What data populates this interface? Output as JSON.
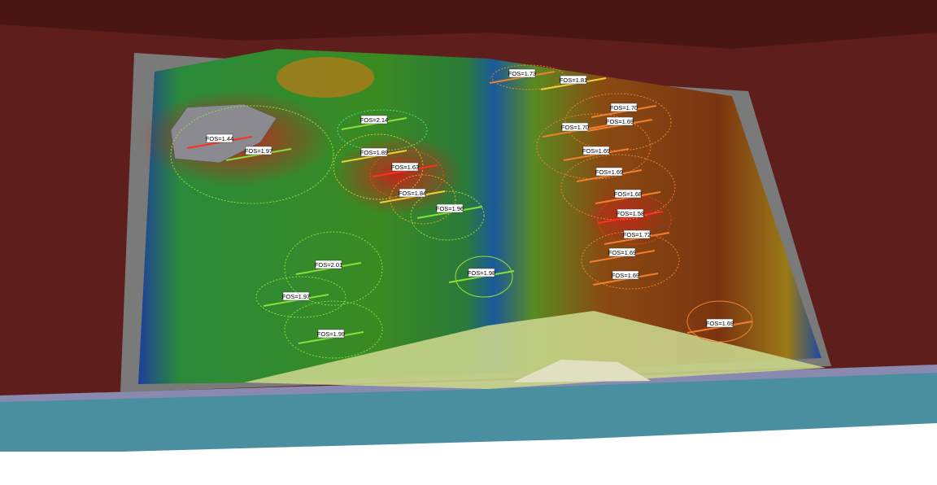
{
  "colors": {
    "terrain": "#5e1f1c",
    "base_layer": "#4a8fa0",
    "embankment": "#c8d48a",
    "low_fos": "#c0261a",
    "high_fos": "#2a8a2a"
  },
  "labels": [
    {
      "text": "FOS=1.44",
      "fos": 1.44
    },
    {
      "text": "FOS=1.97",
      "fos": 1.97
    },
    {
      "text": "FOS=2.14",
      "fos": 2.14
    },
    {
      "text": "FOS=1.89",
      "fos": 1.89
    },
    {
      "text": "FOS=1.63",
      "fos": 1.63
    },
    {
      "text": "FOS=1.84",
      "fos": 1.84
    },
    {
      "text": "FOS=1.96",
      "fos": 1.96
    },
    {
      "text": "FOS=2.01",
      "fos": 2.01
    },
    {
      "text": "FOS=1.97",
      "fos": 1.97
    },
    {
      "text": "FOS=1.99",
      "fos": 1.99
    },
    {
      "text": "FOS=1.98",
      "fos": 1.98
    },
    {
      "text": "FOS=1.73",
      "fos": 1.73
    },
    {
      "text": "FOS=1.81",
      "fos": 1.81
    },
    {
      "text": "FOS=1.70",
      "fos": 1.7
    },
    {
      "text": "FOS=1.69",
      "fos": 1.69
    },
    {
      "text": "FOS=1.70",
      "fos": 1.7
    },
    {
      "text": "FOS=1.69",
      "fos": 1.69
    },
    {
      "text": "FOS=1.69",
      "fos": 1.69
    },
    {
      "text": "FOS=1.68",
      "fos": 1.68
    },
    {
      "text": "FOS=1.58",
      "fos": 1.58
    },
    {
      "text": "FOS=1.72",
      "fos": 1.72
    },
    {
      "text": "FOS=1.69",
      "fos": 1.69
    },
    {
      "text": "FOS=1.69",
      "fos": 1.69
    },
    {
      "text": "FOS=1.69",
      "fos": 1.69
    }
  ]
}
